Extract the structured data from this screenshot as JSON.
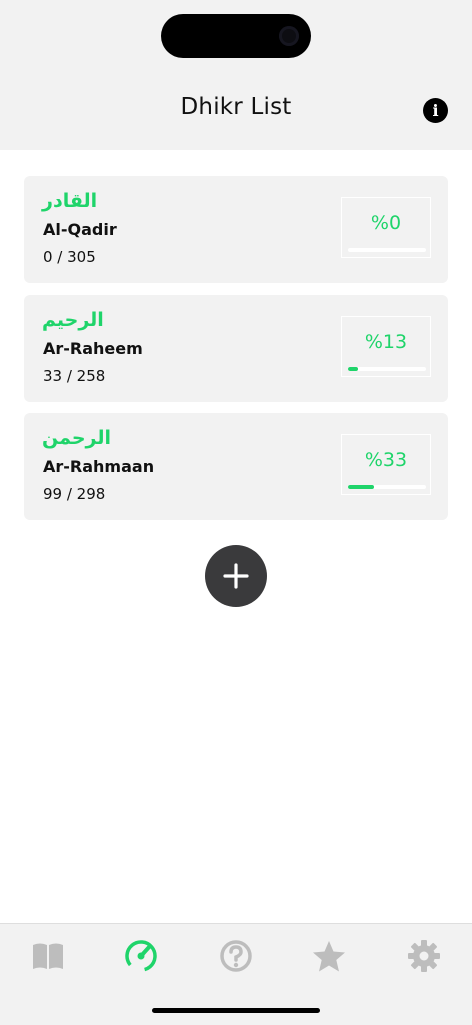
{
  "header": {
    "title": "Dhikr List"
  },
  "cards": [
    {
      "arabic": "القادر",
      "name": "Al-Qadir",
      "count": "0 / 305",
      "percent_label": "%0",
      "progress": 0
    },
    {
      "arabic": "الرحيم",
      "name": "Ar-Raheem",
      "count": "33 / 258",
      "percent_label": "%13",
      "progress": 0.13
    },
    {
      "arabic": "الرحمن",
      "name": "Ar-Rahmaan",
      "count": "99 / 298",
      "percent_label": "%33",
      "progress": 0.33
    }
  ],
  "colors": {
    "accent": "#1fd46a",
    "tab_inactive": "#bdbdbd",
    "button": "#3a3a3c"
  },
  "tabs": [
    {
      "icon": "book-icon",
      "active": false
    },
    {
      "icon": "speedometer-icon",
      "active": true
    },
    {
      "icon": "question-icon",
      "active": false
    },
    {
      "icon": "star-icon",
      "active": false
    },
    {
      "icon": "gear-icon",
      "active": false
    }
  ]
}
